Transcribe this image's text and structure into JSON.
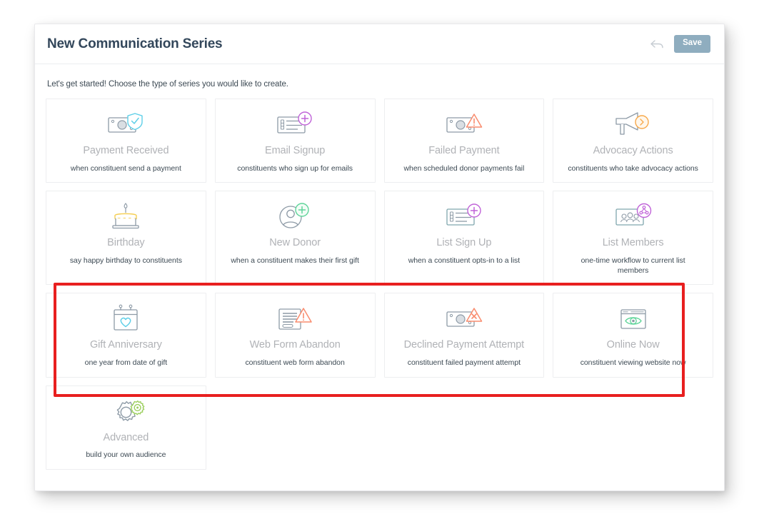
{
  "header": {
    "title": "New Communication Series",
    "back_icon": "back-arrow-icon",
    "save_label": "Save",
    "accent_color": "#8fadbf"
  },
  "intro": {
    "text": "Let's get started! Choose the type of series you would like to create."
  },
  "annotation": {
    "highlight_color": "#e81f1f",
    "highlights_row": 3
  },
  "tiles": [
    {
      "title": "Payment Received",
      "desc": "when constituent send a payment",
      "icon": "banknote-shield-check-icon",
      "accent": "#5fcfe8"
    },
    {
      "title": "Email Signup",
      "desc": "constituents who sign up for emails",
      "icon": "form-list-plus-icon",
      "accent": "#c063d8"
    },
    {
      "title": "Failed Payment",
      "desc": "when scheduled donor payments fail",
      "icon": "banknote-warning-icon",
      "accent": "#f98c6e"
    },
    {
      "title": "Advocacy Actions",
      "desc": "constituents who take advocacy actions",
      "icon": "megaphone-arrow-icon",
      "accent": "#f7a94b"
    },
    {
      "title": "Birthday",
      "desc": "say happy birthday to constituents",
      "icon": "birthday-cake-icon",
      "accent": "#f5cf54"
    },
    {
      "title": "New Donor",
      "desc": "when a constituent makes their first gift",
      "icon": "person-plus-icon",
      "accent": "#5fd49a"
    },
    {
      "title": "List Sign Up",
      "desc": "when a constituent opts-in to a list",
      "icon": "form-list-plus-icon",
      "accent": "#c063d8"
    },
    {
      "title": "List Members",
      "desc": "one-time workflow to current list members",
      "icon": "people-group-network-icon",
      "accent": "#c063d8"
    },
    {
      "title": "Gift Anniversary",
      "desc": "one year from date of gift",
      "icon": "calendar-heart-icon",
      "accent": "#5fcfe8"
    },
    {
      "title": "Web Form Abandon",
      "desc": "constituent web form abandon",
      "icon": "document-warning-icon",
      "accent": "#f98c6e"
    },
    {
      "title": "Declined Payment Attempt",
      "desc": "constituent failed payment attempt",
      "icon": "banknote-warning-x-icon",
      "accent": "#f98c6e"
    },
    {
      "title": "Online Now",
      "desc": "constituent viewing website now",
      "icon": "browser-eye-icon",
      "accent": "#5fd49a"
    },
    {
      "title": "Advanced",
      "desc": "build your own audience",
      "icon": "gears-icon",
      "accent": "#9ccf5e"
    }
  ]
}
